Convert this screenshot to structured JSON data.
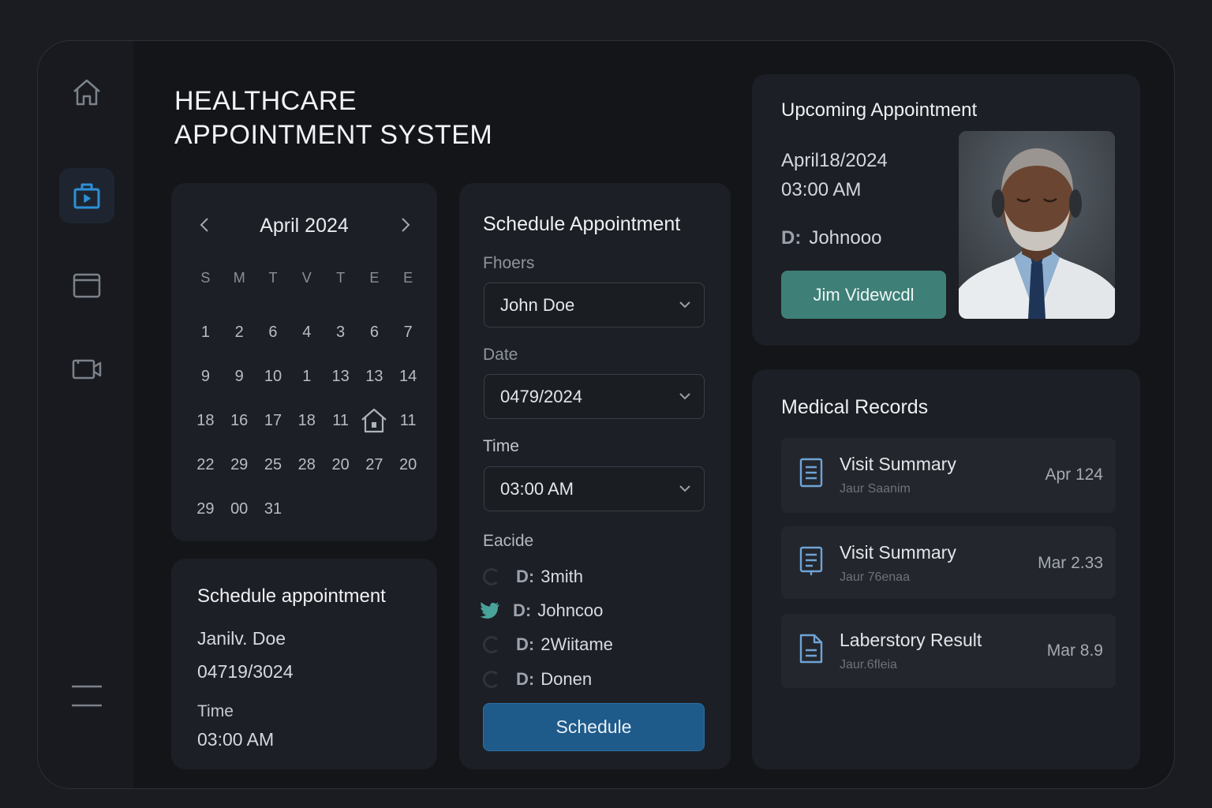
{
  "app": {
    "title_line1": "HEALTHCARE",
    "title_line2": "APPOINTMENT SYSTEM"
  },
  "sidebar": {
    "items": [
      {
        "icon": "home-icon",
        "active": false
      },
      {
        "icon": "medical-bag-icon",
        "active": true
      },
      {
        "icon": "calendar-icon",
        "active": false
      },
      {
        "icon": "video-camera-icon",
        "active": false
      },
      {
        "icon": "menu-icon",
        "active": false
      }
    ],
    "accent": "#2d8fd5"
  },
  "calendar": {
    "month_label": "April 2024",
    "weekdays": [
      "S",
      "M",
      "T",
      "V",
      "T",
      "E",
      "E"
    ],
    "weeks": [
      [
        "1",
        "2",
        "6",
        "4",
        "3",
        "6",
        "7"
      ],
      [
        "9",
        "9",
        "10",
        "1",
        "13",
        "13",
        "14"
      ],
      [
        "18",
        "16",
        "17",
        "18",
        "11",
        "",
        "11"
      ],
      [
        "22",
        "29",
        "25",
        "28",
        "20",
        "27",
        "20"
      ],
      [
        "29",
        "00",
        "31"
      ]
    ]
  },
  "summary_card": {
    "title": "Schedule appointment",
    "patient": "Janilv. Doe",
    "date": "04719/3024",
    "time_label": "Time",
    "time": "03:00 AM"
  },
  "schedule_form": {
    "title": "Schedule Appointment",
    "patient_label": "Fhoers",
    "patient_value": "John Doe",
    "date_label": "Date",
    "date_value": "0479/2024",
    "time_label": "Time",
    "time_value": "03:00 AM",
    "doctor_label": "Eacide",
    "doctors": [
      {
        "prefix": "D:",
        "name": "3mith"
      },
      {
        "prefix": "D:",
        "name": "Johncoo"
      },
      {
        "prefix": "D:",
        "name": "2Wiitame"
      },
      {
        "prefix": "D:",
        "name": "Donen"
      }
    ],
    "submit_label": "Schedule"
  },
  "upcoming": {
    "title": "Upcoming Appointment",
    "date": "April18/2024",
    "time": "03:00 AM",
    "doctor_prefix": "D:",
    "doctor_name": "Johnooo",
    "join_label": "Jim Videwcdl"
  },
  "records": {
    "title": "Medical Records",
    "items": [
      {
        "name": "Visit Summary",
        "sub": "Jaur Saanim",
        "date": "Apr 124"
      },
      {
        "name": "Visit Summary",
        "sub": "Jaur 76enaa",
        "date": "Mar 2.33"
      },
      {
        "name": "Laberstory Result",
        "sub": "Jaur.6fleia",
        "date": "Mar 8.9"
      }
    ]
  },
  "colors": {
    "primary_button": "#1e5a8a",
    "video_button": "#3e7f77",
    "card_bg": "#1c1f25"
  }
}
